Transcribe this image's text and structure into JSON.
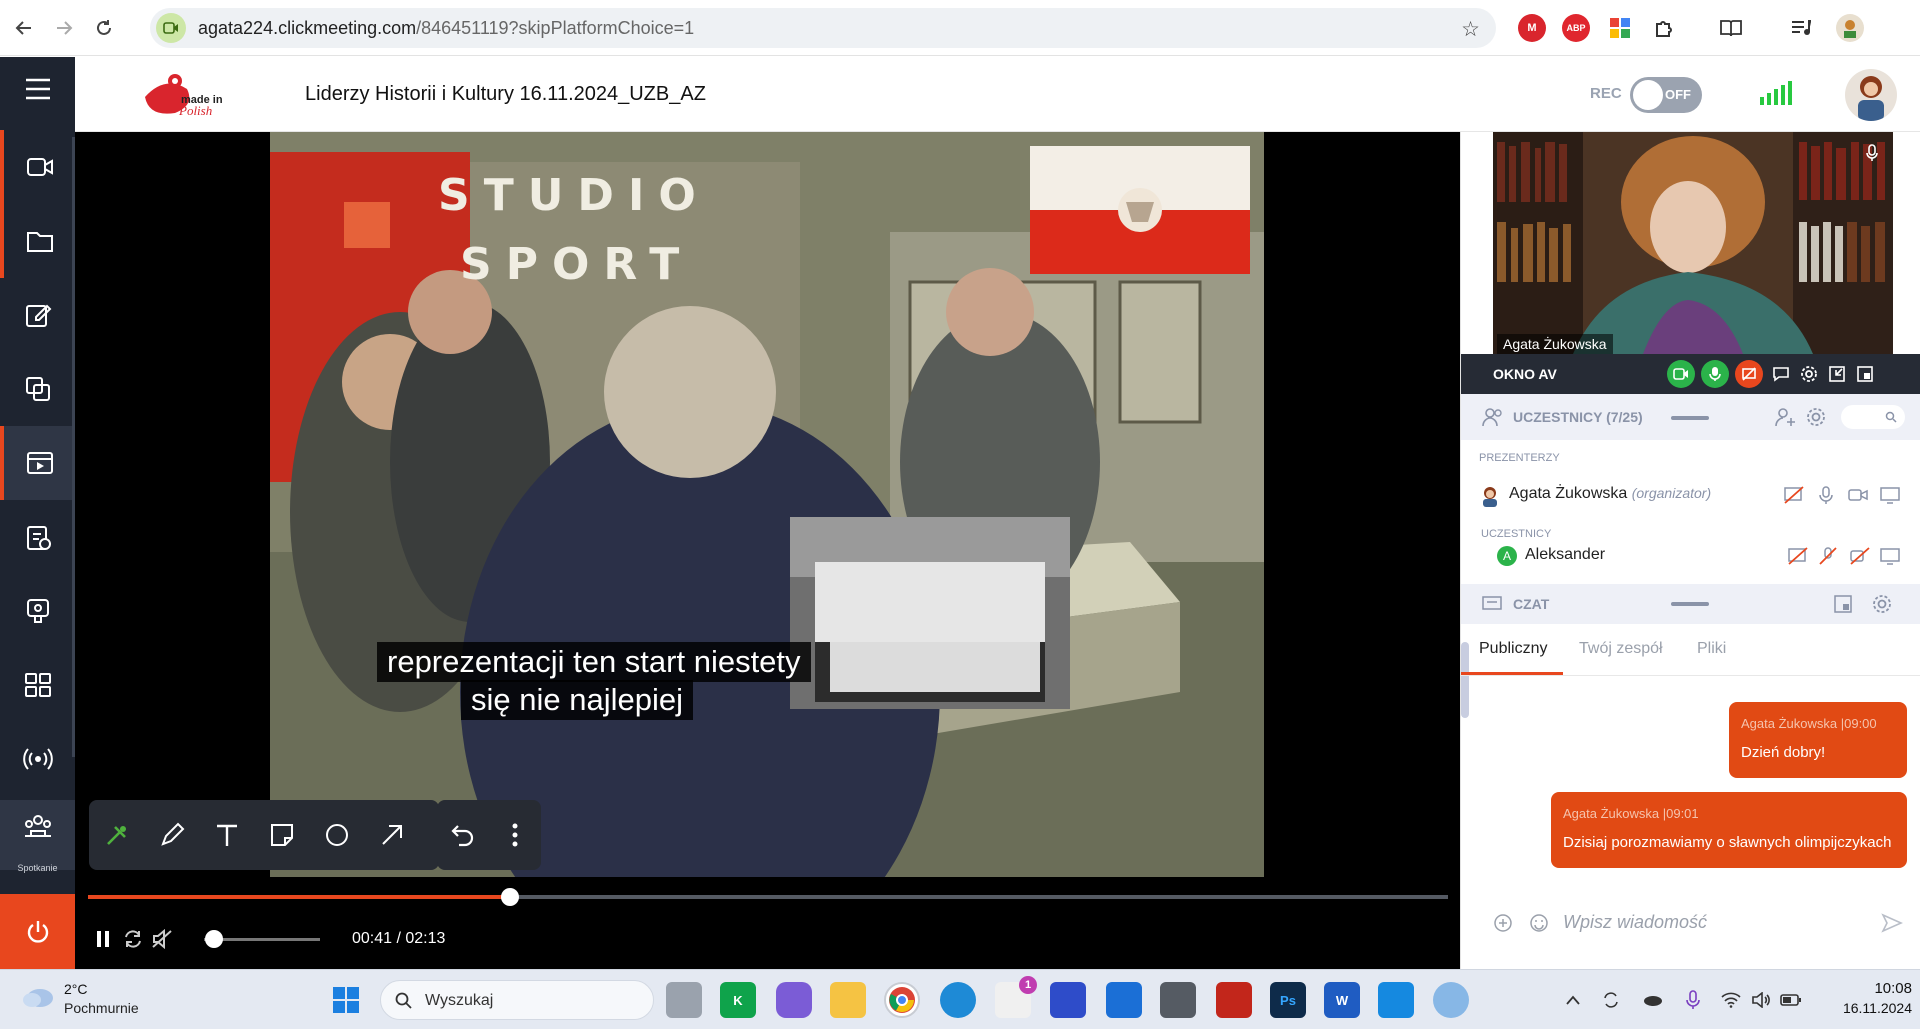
{
  "browser": {
    "url_host": "agata224.clickmeeting.com",
    "url_path": "/846451119?skipPlatformChoice=1",
    "extensions": [
      "mega-icon",
      "adblock-icon",
      "google-icon",
      "puzzle-icon"
    ],
    "abp_label": "ABP"
  },
  "header": {
    "logo_text": "made in Polish",
    "title": "Liderzy Historii i Kultury 16.11.2024_UZB_AZ",
    "rec_label": "REC",
    "rec_toggle": "OFF"
  },
  "sidebar": {
    "items": [
      "camera",
      "folder",
      "edit",
      "copy",
      "media",
      "tests",
      "video-guide",
      "apps",
      "broadcast",
      "meeting"
    ],
    "meeting_label": "Spotkanie"
  },
  "video": {
    "studio_word1": "STUDIO",
    "studio_word2": "SPORT",
    "subtitle_line1": "reprezentacji ten start niestety",
    "subtitle_line2": "się nie najlepiej",
    "time": "00:41 / 02:13",
    "progress": 0.31,
    "volume": 0.0
  },
  "panel": {
    "cam_name": "Agata Żukowska",
    "av_label": "OKNO AV",
    "participants_title": "UCZESTNICY (7/25)",
    "presenters_label": "PREZENTERZY",
    "presenter_name": "Agata Żukowska",
    "presenter_role": "(organizator)",
    "attendees_label": "UCZESTNICY",
    "attendee_name": "Aleksander",
    "attendee_initial": "A",
    "chat_title": "CZAT",
    "tabs": [
      "Publiczny",
      "Twój zespół",
      "Pliki"
    ],
    "messages": [
      {
        "author": "Agata Żukowska",
        "time": "09:00",
        "text": "Dzień dobry!"
      },
      {
        "author": "Agata Żukowska",
        "time": "09:01",
        "text": "Dzisiaj porozmawiamy o sławnych olimpijczykach"
      }
    ],
    "input_placeholder": "Wpisz wiadomość"
  },
  "taskbar": {
    "temp": "2°C",
    "condition": "Pochmurnie",
    "search": "Wyszukaj",
    "store_badge": "1",
    "ps_label": "Ps",
    "word_label": "W",
    "time": "10:08",
    "date": "16.11.2024"
  },
  "colors": {
    "accent": "#e8471e",
    "sidebar": "#1e2430",
    "chat_bubble": "#e14a14",
    "signal": "#28c940"
  }
}
